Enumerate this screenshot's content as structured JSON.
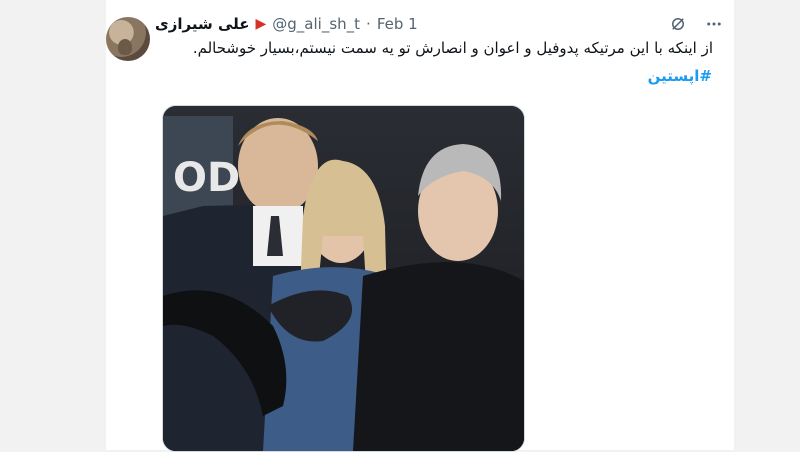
{
  "tweet": {
    "author_name": "علی شیرازی",
    "flag_icon": "red-flag-icon",
    "handle": "@g_ali_sh_t",
    "separator": "·",
    "date": "Feb 1",
    "text": "از اینکه با این مرتیکه پدوفیل و اعوان و انصارش تو یه سمت نیستم،بسیار خوشحالم.",
    "hashtag": "#اپستین",
    "icons": {
      "grok": "grok-icon",
      "more": "more-icon"
    },
    "colors": {
      "link": "#1d9bf0",
      "secondary": "#536471",
      "text": "#0f1419"
    }
  }
}
